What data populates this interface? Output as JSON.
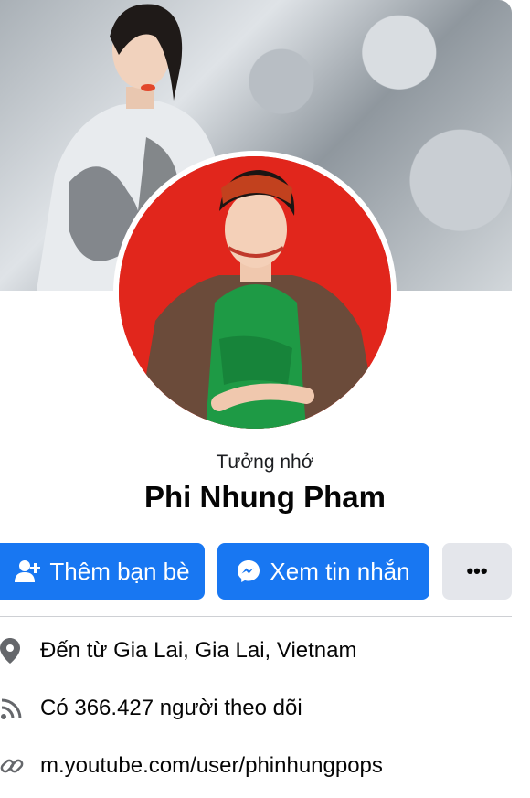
{
  "profile": {
    "memorial_label": "Tưởng nhớ",
    "name": "Phi Nhung Pham"
  },
  "actions": {
    "add_friend_label": "Thêm bạn bè",
    "view_messages_label": "Xem tin nhắn",
    "more_label": "•••"
  },
  "info": {
    "location_prefix": "Đến từ ",
    "location": "Gia Lai, Gia Lai, Vietnam",
    "followers_prefix": "Có ",
    "followers_count": "366.427",
    "followers_suffix": " người theo dõi",
    "link": "m.youtube.com/user/phinhungpops"
  },
  "colors": {
    "primary": "#1877f2",
    "secondary_button": "#e4e6eb",
    "avatar_background": "#e1261c"
  },
  "icons": {
    "add_friend": "person-plus-icon",
    "messenger": "messenger-icon",
    "location": "location-pin-icon",
    "followers": "rss-feed-icon",
    "link": "link-icon"
  }
}
